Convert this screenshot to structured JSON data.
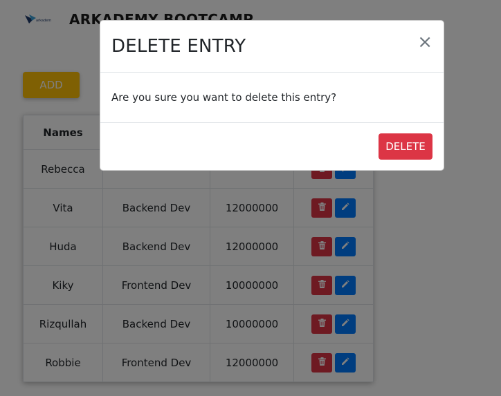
{
  "header": {
    "brand_title": "ARKADEMY BOOTCAMP",
    "logo_icon": "arkademy-logo-icon"
  },
  "toolbar": {
    "add_label": "ADD"
  },
  "table": {
    "columns": [
      "Names",
      "",
      "",
      ""
    ],
    "rows": [
      {
        "name": "Rebecca",
        "role": "",
        "salary": ""
      },
      {
        "name": "Vita",
        "role": "Backend Dev",
        "salary": "12000000"
      },
      {
        "name": "Huda",
        "role": "Backend Dev",
        "salary": "12000000"
      },
      {
        "name": "Kiky",
        "role": "Frontend Dev",
        "salary": "10000000"
      },
      {
        "name": "Rizqullah",
        "role": "Backend Dev",
        "salary": "10000000"
      },
      {
        "name": "Robbie",
        "role": "Frontend Dev",
        "salary": "12000000"
      }
    ],
    "row_action_icons": [
      "trash-icon",
      "pencil-icon"
    ]
  },
  "modal": {
    "title": "DELETE ENTRY",
    "close_symbol": "×",
    "body_text": "Are you sure you want to delete this entry?",
    "delete_label": "DELETE"
  },
  "colors": {
    "add_button": "#ffc107",
    "delete_button": "#dc3545",
    "edit_button": "#007bff",
    "backdrop": "rgba(0,0,0,0.5)"
  }
}
